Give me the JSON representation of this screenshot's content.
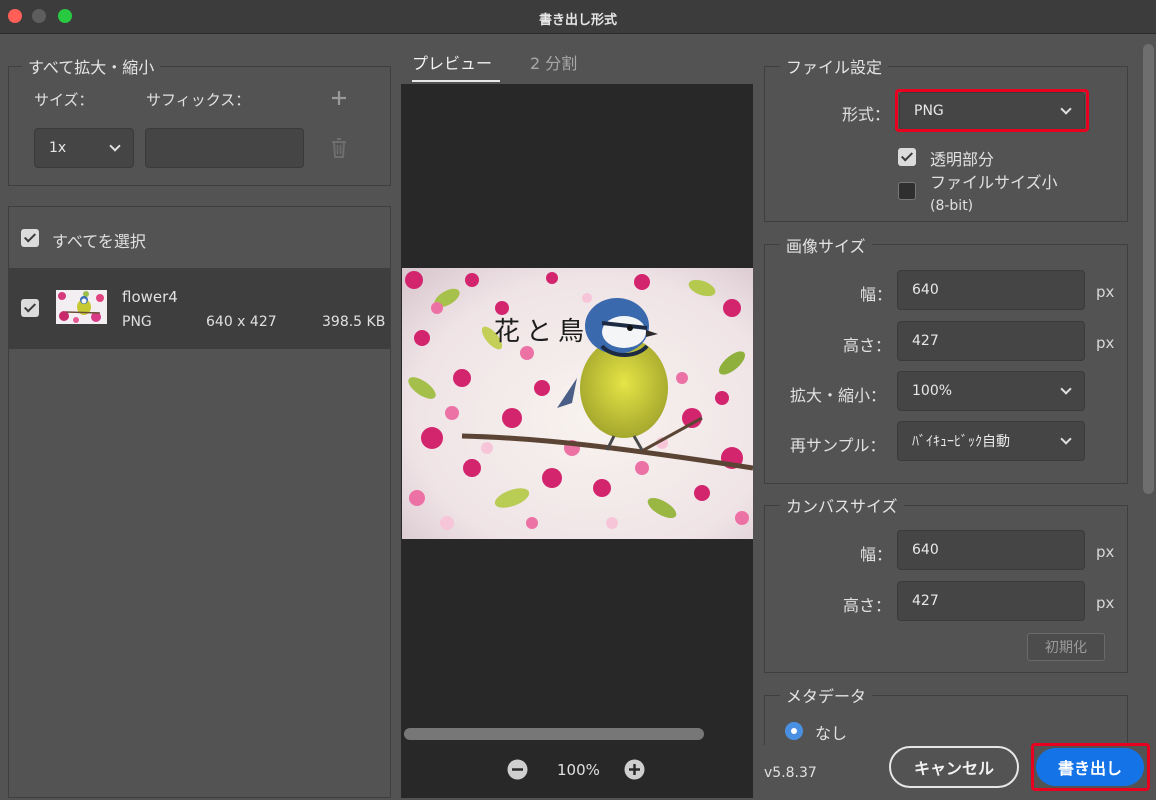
{
  "window": {
    "title": "書き出し形式"
  },
  "scale_all": {
    "legend": "すべて拡大・縮小",
    "size_label": "サイズ：",
    "suffix_label": "サフィックス：",
    "size_value": "1x",
    "suffix_value": ""
  },
  "assets": {
    "select_all_label": "すべてを選択",
    "select_all_checked": true,
    "items": [
      {
        "name": "flower4",
        "format": "PNG",
        "dimensions": "640 x 427",
        "file_size": "398.5 KB",
        "checked": true
      }
    ]
  },
  "preview": {
    "tabs": [
      {
        "label": "プレビュー",
        "active": true
      },
      {
        "label": "2 分割",
        "active": false
      }
    ],
    "image_caption": "花と鳥",
    "zoom": "100%"
  },
  "file_settings": {
    "legend": "ファイル設定",
    "format_label": "形式：",
    "format_value": "PNG",
    "transparency_label": "透明部分",
    "transparency_checked": true,
    "smaller_file_label": "ファイルサイズ小",
    "smaller_file_sub": "(8-bit)",
    "smaller_file_checked": false
  },
  "image_size": {
    "legend": "画像サイズ",
    "width_label": "幅：",
    "width_value": "640",
    "height_label": "高さ：",
    "height_value": "427",
    "scale_label": "拡大・縮小：",
    "scale_value": "100%",
    "resample_label": "再サンプル：",
    "resample_value": "ﾊﾞｲｷｭｰﾋﾞｯｸ自動",
    "unit": "px"
  },
  "canvas_size": {
    "legend": "カンバスサイズ",
    "width_label": "幅：",
    "width_value": "640",
    "height_label": "高さ：",
    "height_value": "427",
    "unit": "px",
    "reset_label": "初期化"
  },
  "metadata": {
    "legend": "メタデータ",
    "option_none": "なし"
  },
  "footer": {
    "version": "v5.8.37",
    "cancel_label": "キャンセル",
    "export_label": "書き出し"
  },
  "colors": {
    "accent": "#1473e6",
    "highlight": "#e8001f",
    "panel_bg": "#535353",
    "preview_bg": "#282828"
  }
}
